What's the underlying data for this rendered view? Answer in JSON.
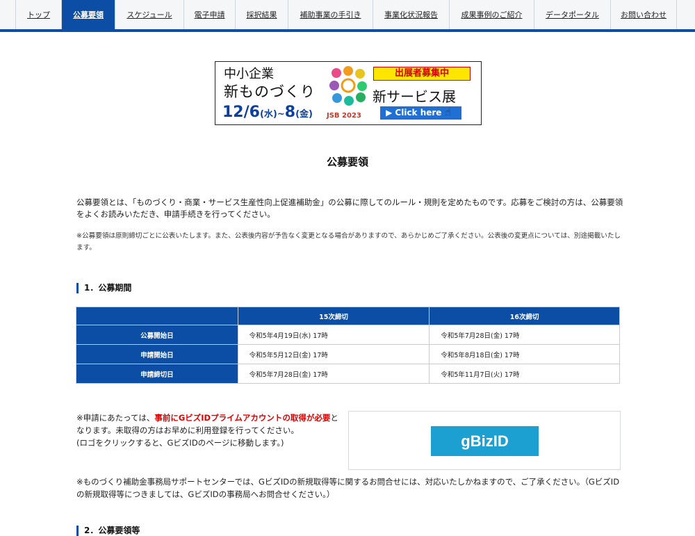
{
  "nav": {
    "items": [
      {
        "label": "トップ",
        "active": false
      },
      {
        "label": "公募要領",
        "active": true
      },
      {
        "label": "スケジュール",
        "active": false
      },
      {
        "label": "電子申請",
        "active": false
      },
      {
        "label": "採択結果",
        "active": false
      },
      {
        "label": "補助事業の手引き",
        "active": false
      },
      {
        "label": "事業化状況報告",
        "active": false
      },
      {
        "label": "成果事例のご紹介",
        "active": false
      },
      {
        "label": "データポータル",
        "active": false
      },
      {
        "label": "お問い合わせ",
        "active": false
      }
    ]
  },
  "banner": {
    "line1": "中小企業",
    "line2": "新ものづくり",
    "date_main": "12/6",
    "date_wed": "(水)",
    "date_sep": "~",
    "date_end": "8",
    "date_fri": "(金)",
    "badge": "出展者募集中",
    "service": "新サービス展",
    "click": "▶ Click here",
    "jsb": "JSB 2023"
  },
  "page": {
    "title": "公募要領",
    "intro": "公募要領とは、「ものづくり・商業・サービス生産性向上促進補助金」の公募に際してのルール・規則を定めたものです。応募をご検討の方は、公募要領をよくお読みいただき、申請手続きを行ってください。",
    "note": "※公募要領は原則締切ごとに公表いたします。また、公表後内容が予告なく変更となる場合がありますので、あらかじめご了承ください。公表後の変更点については、別途掲載いたします。"
  },
  "section1": {
    "heading": "1．公募期間",
    "columns": [
      "",
      "15次締切",
      "16次締切"
    ],
    "rows": [
      {
        "label": "公募開始日",
        "c15": "令和5年4月19日(水) 17時",
        "c16": "令和5年7月28日(金) 17時"
      },
      {
        "label": "申請開始日",
        "c15": "令和5年5月12日(金) 17時",
        "c16": "令和5年8月18日(金) 17時"
      },
      {
        "label": "申請締切日",
        "c15": "令和5年7月28日(金) 17時",
        "c16": "令和5年11月7日(火) 17時"
      }
    ]
  },
  "gbiz": {
    "pre": "※申請にあたっては、",
    "emphasis": "事前にGビズIDプライムアカウントの取得が必要",
    "post": "となります。未取得の方はお早めに利用登録を行ってください。",
    "logo_note": "(ロゴをクリックすると、GビズIDのページに移動します。)",
    "logo": "gBizID",
    "support": "※ものづくり補助金事務局サポートセンターでは、GビズIDの新規取得等に関するお問合せには、対応いたしかねますので、ご了承ください。（GビズIDの新規取得等につきましては、GビズIDの事務局へお問合せください。）"
  },
  "section2": {
    "heading": "2．公募要領等"
  },
  "colors": {
    "brand_blue": "#0c4ea6",
    "emphasis_red": "#e00000",
    "gbiz_blue": "#1c9fd1"
  }
}
